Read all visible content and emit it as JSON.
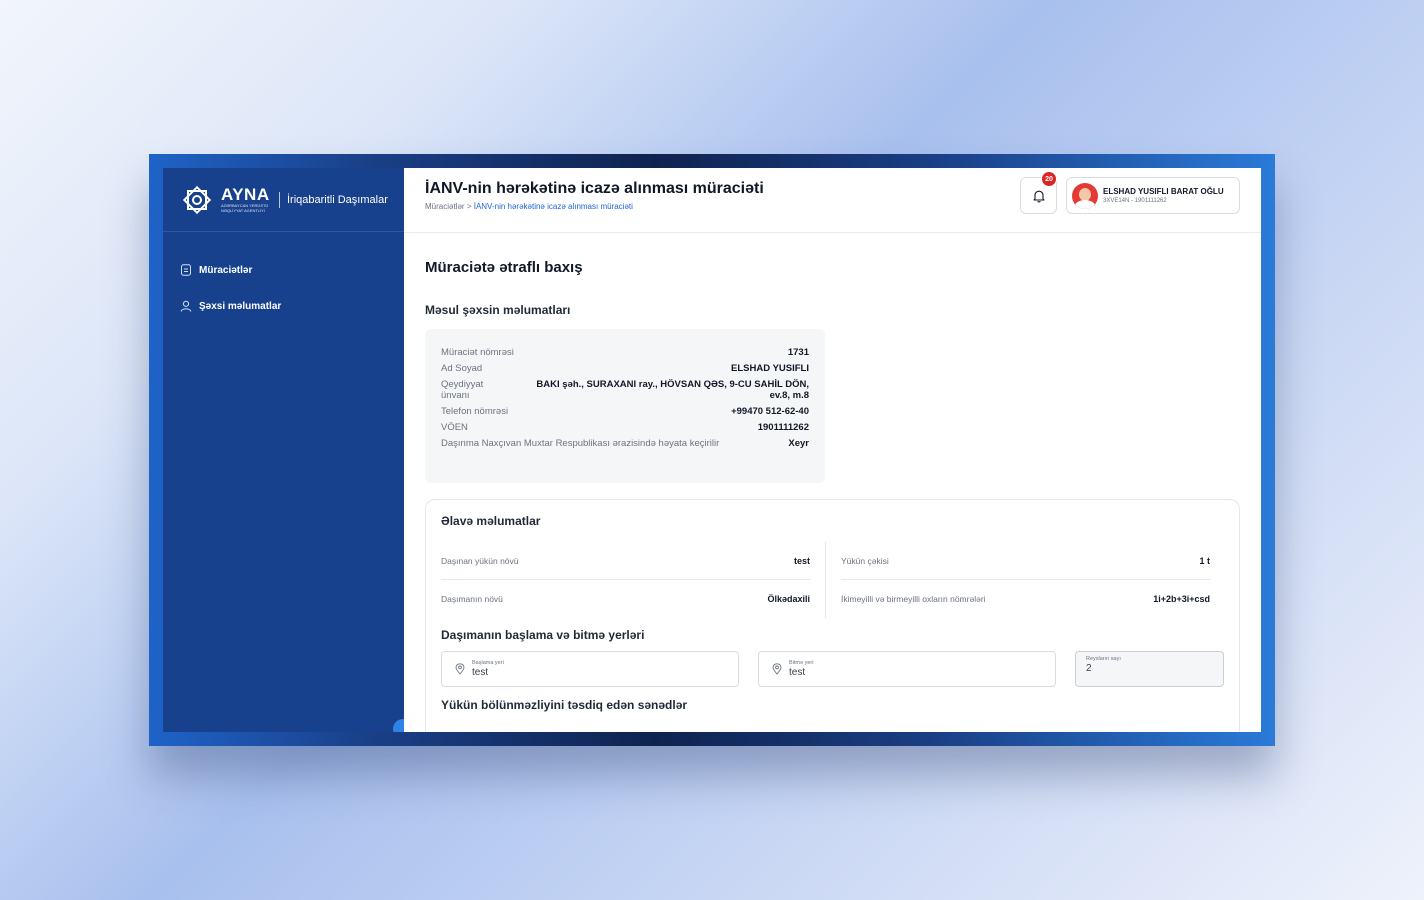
{
  "brand": {
    "name": "AYNA",
    "subtitle": "AZƏRBAYCAN YERÜSTÜ NƏQLİYYAT AGENTLİYİ",
    "app_name": "İriqabaritli Daşımalar"
  },
  "sidebar": {
    "items": [
      {
        "label": "Müraciətlər",
        "icon": "document-icon"
      },
      {
        "label": "Şəxsi məlumatlar",
        "icon": "user-icon"
      }
    ]
  },
  "header": {
    "title": "İANV-nin hərəkətinə icazə alınması müraciəti",
    "breadcrumb": {
      "root": "Müraciətlər",
      "separator": ">",
      "current": "İANV-nin hərəkətinə icazə alınması müraciəti"
    },
    "notifications_count": "20",
    "user": {
      "name": "ELSHAD YUSIFLI BARAT OĞLU",
      "id": "3XVE14N - 1901111262"
    }
  },
  "main": {
    "heading": "Müraciətə ətraflı baxış",
    "responsible_heading": "Məsul şəxsin məlumatları",
    "responsible": {
      "application_number_label": "Müraciət nömrəsi",
      "application_number": "1731",
      "full_name_label": "Ad Soyad",
      "full_name": "ELSHAD YUSIFLI",
      "address_label": "Qeydiyyat ünvanı",
      "address": "BAKI şəh., SURAXANI ray., HÖVSAN QƏS, 9-CU SAHİL DÖN, ev.8, m.8",
      "phone_label": "Telefon nömrəsi",
      "phone": "+99470 512-62-40",
      "voen_label": "VÖEN",
      "voen": "1901111262",
      "nakhchivan_label": "Daşınma Naxçıvan Muxtar Respublikası ərazisində həyata keçirilir",
      "nakhchivan": "Xeyr"
    },
    "extra": {
      "heading": "Əlavə məlumatlar",
      "cargo_type_label": "Daşınan yükün növü",
      "cargo_type": "test",
      "cargo_weight_label": "Yükün çəkisi",
      "cargo_weight": "1 t",
      "transport_type_label": "Daşımanın növü",
      "transport_type": "Ölkədaxili",
      "axle_numbers_label": "İkimeyilli və birmeyilli oxların nömrələri",
      "axle_numbers": "1i+2b+3i+csd",
      "places_heading": "Daşımanın başlama və bitmə yerləri",
      "start_label": "Başlama yeri",
      "start_value": "test",
      "end_label": "Bitmə yeri",
      "end_value": "test",
      "trips_label": "Reysların sayı",
      "trips_value": "2",
      "documents_heading": "Yükün bölünməzliyini təsdiq edən sənədlər"
    }
  }
}
